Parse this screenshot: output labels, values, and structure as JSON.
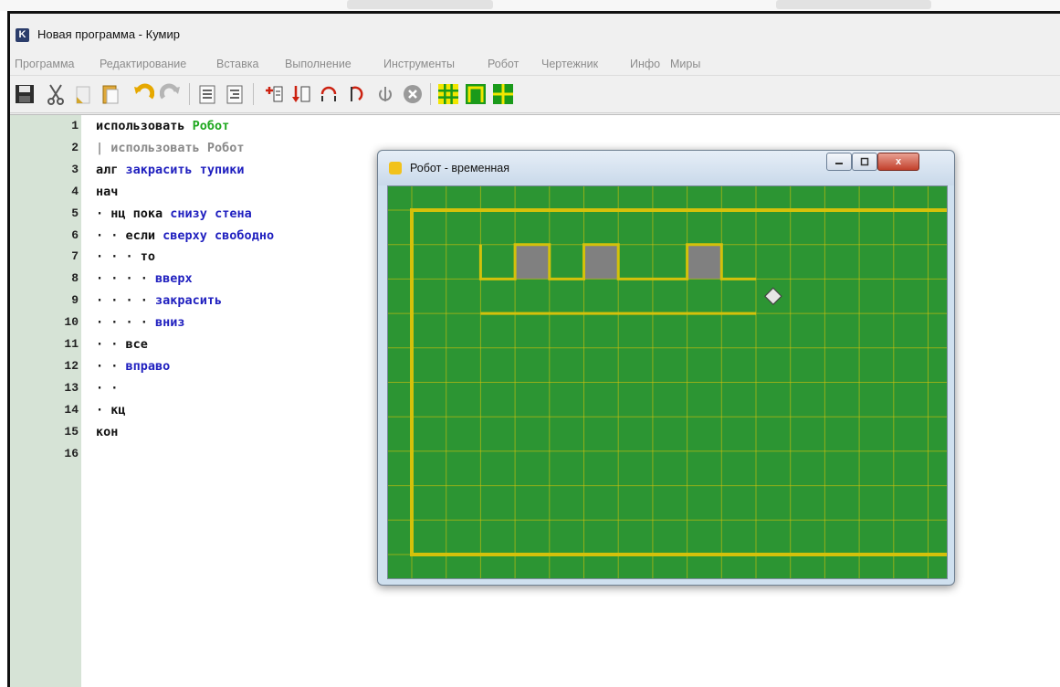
{
  "window": {
    "title": "Новая программа - Кумир",
    "logo_letter": "K"
  },
  "menu": {
    "items": [
      "Программа",
      "Редактирование",
      "Вставка",
      "Выполнение",
      "Инструменты",
      "Робот",
      "Чертежник",
      "Инфо",
      "Миры"
    ]
  },
  "toolbar": {
    "buttons": [
      "save",
      "cut",
      "copy",
      "paste",
      "undo",
      "redo",
      "comment",
      "uncomment",
      "run-step",
      "step-in",
      "step-over",
      "step-out",
      "step-back",
      "stop",
      "robot-field",
      "robot-walls",
      "robot-cross"
    ]
  },
  "editor": {
    "line_numbers": [
      "1",
      "2",
      "3",
      "4",
      "5",
      "6",
      "7",
      "8",
      "9",
      "10",
      "11",
      "12",
      "13",
      "14",
      "15",
      "16"
    ],
    "lines": [
      [
        {
          "t": "использовать ",
          "c": "kw"
        },
        {
          "t": "Робот",
          "c": "gr"
        }
      ],
      [
        {
          "t": "| использовать Робот",
          "c": "gy"
        }
      ],
      [
        {
          "t": "алг ",
          "c": "kw"
        },
        {
          "t": "закрасить тупики",
          "c": "bl"
        }
      ],
      [
        {
          "t": "нач",
          "c": "kw"
        }
      ],
      [
        {
          "t": "· ",
          "c": "dots"
        },
        {
          "t": "нц пока ",
          "c": "kw"
        },
        {
          "t": "снизу стена",
          "c": "bl"
        }
      ],
      [
        {
          "t": "· · ",
          "c": "dots"
        },
        {
          "t": "если ",
          "c": "kw"
        },
        {
          "t": "сверху свободно",
          "c": "bl"
        }
      ],
      [
        {
          "t": "· · · ",
          "c": "dots"
        },
        {
          "t": "то",
          "c": "kw"
        }
      ],
      [
        {
          "t": "· · · · ",
          "c": "dots"
        },
        {
          "t": "вверх",
          "c": "bl"
        }
      ],
      [
        {
          "t": "· · · · ",
          "c": "dots"
        },
        {
          "t": "закрасить",
          "c": "bl"
        }
      ],
      [
        {
          "t": "· · · · ",
          "c": "dots"
        },
        {
          "t": "вниз",
          "c": "bl"
        }
      ],
      [
        {
          "t": "· · ",
          "c": "dots"
        },
        {
          "t": "все",
          "c": "kw"
        }
      ],
      [
        {
          "t": "· · ",
          "c": "dots"
        },
        {
          "t": "вправо",
          "c": "bl"
        }
      ],
      [
        {
          "t": "· ·",
          "c": "dots"
        }
      ],
      [
        {
          "t": "· ",
          "c": "dots"
        },
        {
          "t": "кц",
          "c": "kw"
        }
      ],
      [
        {
          "t": "кон",
          "c": "kw"
        }
      ],
      []
    ]
  },
  "robot_window": {
    "title": "Робот - временная",
    "close_label": "x",
    "field": {
      "columns": 16,
      "rows": 10,
      "background_color": "#2c9533",
      "wall_color": "#d4c10a",
      "painted_color": "#808080",
      "painted_cells": [
        [
          3,
          1
        ],
        [
          5,
          1
        ],
        [
          8,
          1
        ]
      ],
      "robot_cell": [
        10,
        2
      ]
    }
  }
}
